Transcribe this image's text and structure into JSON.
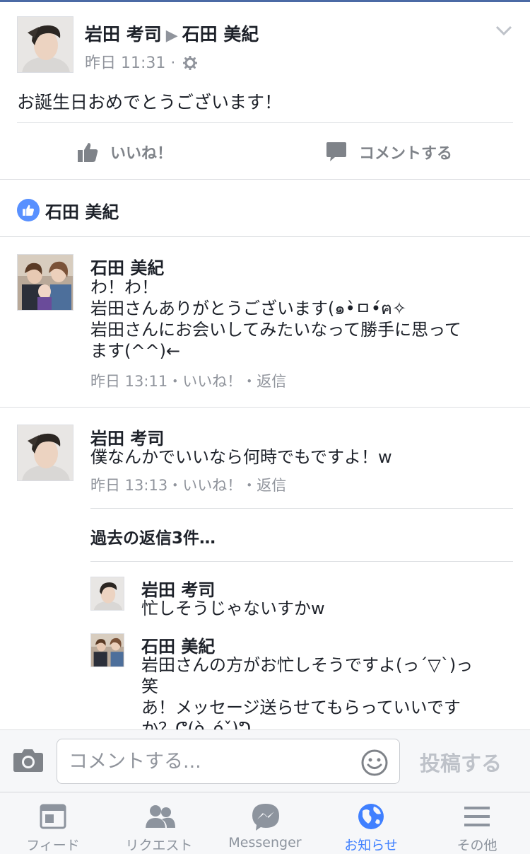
{
  "post": {
    "author": "岩田 考司",
    "arrow": "▶",
    "target": "石田 美紀",
    "time": "昨日 11:31",
    "separator": "·",
    "text": "お誕生日おめでとうございます！",
    "like_label": "いいね！",
    "comment_label": "コメントする",
    "liked_by": "石田 美紀"
  },
  "comments": [
    {
      "name": "石田 美紀",
      "text": "わ！わ！\n岩田さんありがとうございます(๑•̀ㅁ•́ฅ✧\n岩田さんにお会いしてみたいなって勝手に思って\nます(^^)←",
      "meta": "昨日 13:11・いいね！・返信"
    },
    {
      "name": "岩田 考司",
      "text": "僕なんかでいいなら何時でもですよ！w",
      "meta": "昨日 13:13・いいね！・返信"
    }
  ],
  "more_replies": "過去の返信3件…",
  "replies": [
    {
      "name": "岩田 考司",
      "text": "忙しそうじゃないすかw"
    },
    {
      "name": "石田 美紀",
      "text": "岩田さんの方がお忙しそうですよ(っ´▽`)っ\n笑\nあ！メッセージ送らせてもらっていいです\nか？ᕦ(ò_óˇ)ᕤ"
    }
  ],
  "composer": {
    "placeholder": "コメントする...",
    "post_label": "投稿する"
  },
  "tabs": [
    {
      "label": "フィード",
      "icon": "feed-icon"
    },
    {
      "label": "リクエスト",
      "icon": "friend-requests-icon"
    },
    {
      "label": "Messenger",
      "icon": "messenger-icon"
    },
    {
      "label": "お知らせ",
      "icon": "globe-icon",
      "active": true
    },
    {
      "label": "その他",
      "icon": "menu-icon"
    }
  ],
  "colors": {
    "accent": "#4080ff",
    "like_badge": "#5890ff",
    "meta_text": "#90949c",
    "topline": "#4b6aa5"
  }
}
